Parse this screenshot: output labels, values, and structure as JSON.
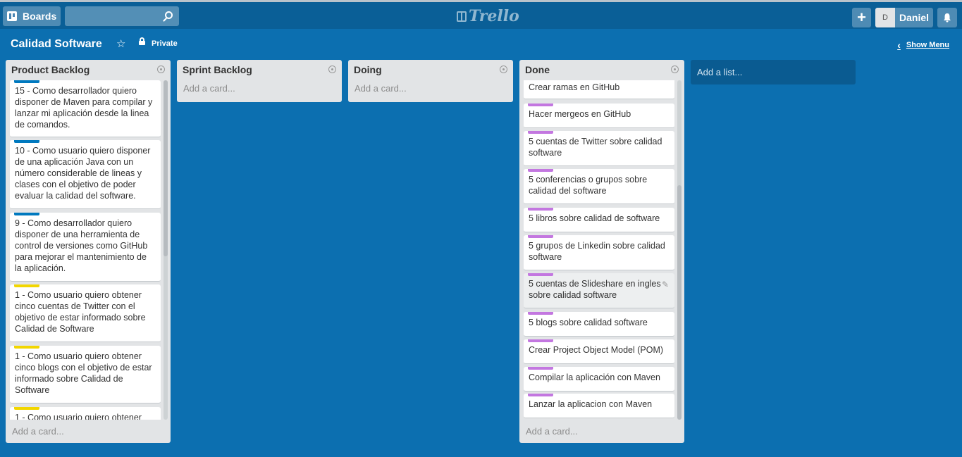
{
  "topbar": {
    "boards_label": "Boards",
    "search_value": "",
    "logo_text": "Trello",
    "member_initial": "D",
    "member_name": "Daniel"
  },
  "board": {
    "title": "Calidad Software",
    "privacy": "Private",
    "show_menu": "Show Menu"
  },
  "lists": [
    {
      "title": "Product Backlog",
      "add_card": "Add a card...",
      "cards": [
        {
          "label_color": "#0079bf",
          "text": "15 - Como desarrollador quiero disponer de Maven para compilar y lanzar mi aplicación desde la linea de comandos."
        },
        {
          "label_color": "#0079bf",
          "text": "10 - Como usuario quiero disponer de una aplicación Java con un número considerable de lineas y clases con el objetivo de poder evaluar la calidad del software."
        },
        {
          "label_color": "#0079bf",
          "text": "9 - Como desarrollador quiero disponer de una herramienta de control de versiones como GitHub para mejorar el mantenimiento de la aplicación."
        },
        {
          "label_color": "#f2d600",
          "text": "1 - Como usuario quiero obtener cinco cuentas de Twitter con el objetivo de estar informado sobre Calidad de Software"
        },
        {
          "label_color": "#f2d600",
          "text": "1 - Como usuario quiero obtener cinco blogs con el objetivo de estar informado sobre Calidad de Software"
        },
        {
          "label_color": "#f2d600",
          "text": "1 - Como usuario quiero obtener"
        }
      ]
    },
    {
      "title": "Sprint Backlog",
      "add_card": "Add a card..."
    },
    {
      "title": "Doing",
      "add_card": "Add a card..."
    },
    {
      "title": "Done",
      "add_card": "Add a card...",
      "cards": [
        {
          "label_color": "#c377e0",
          "text": "Crear ramas en GitHub"
        },
        {
          "label_color": "#c377e0",
          "text": "Hacer mergeos en GitHub"
        },
        {
          "label_color": "#c377e0",
          "text": "5 cuentas de Twitter sobre calidad software"
        },
        {
          "label_color": "#c377e0",
          "text": "5 conferencias o grupos sobre calidad del software"
        },
        {
          "label_color": "#c377e0",
          "text": "5 libros sobre calidad de software"
        },
        {
          "label_color": "#c377e0",
          "text": "5 grupos de Linkedin sobre calidad software"
        },
        {
          "label_color": "#c377e0",
          "text": "5 cuentas de Slideshare en ingles sobre calidad software"
        },
        {
          "label_color": "#c377e0",
          "text": "5 blogs sobre calidad software"
        },
        {
          "label_color": "#c377e0",
          "text": "Crear Project Object Model (POM)"
        },
        {
          "label_color": "#c377e0",
          "text": "Compilar la aplicación con Maven"
        },
        {
          "label_color": "#c377e0",
          "text": "Lanzar la aplicacion con Maven"
        }
      ]
    }
  ],
  "add_list": "Add a list...",
  "icons": [
    "boards-icon",
    "search-icon",
    "trello-logo-icon",
    "plus-icon",
    "bell-icon",
    "star-icon",
    "lock-icon",
    "chevron-left-icon",
    "list-menu-icon",
    "pencil-icon"
  ]
}
